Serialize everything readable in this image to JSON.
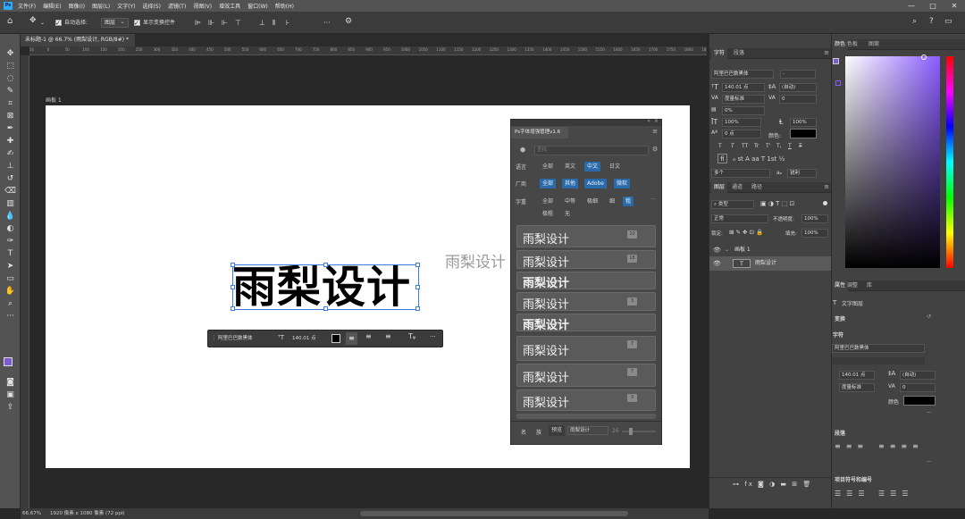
{
  "app": {
    "logo": "Ps"
  },
  "menu": [
    "文件(F)",
    "编辑(E)",
    "图像(I)",
    "图层(L)",
    "文字(Y)",
    "选择(S)",
    "滤镜(T)",
    "视图(V)",
    "增效工具",
    "窗口(W)",
    "帮助(H)"
  ],
  "window_controls": {
    "minimize": "—",
    "maximize": "□",
    "close": "✕"
  },
  "options_bar": {
    "auto_select_label": "自动选择:",
    "auto_select_value": "图层",
    "show_transform_label": "显示变换控件",
    "more": "···"
  },
  "document": {
    "tab_title": "未标题-1 @ 66.7% (雨梨设计, RGB/8#) *",
    "artboard_label": "画板 1"
  },
  "ruler_ticks": [
    "50",
    "0",
    "50",
    "100",
    "150",
    "200",
    "250",
    "300",
    "350",
    "400",
    "450",
    "500",
    "550",
    "600",
    "650",
    "700",
    "750",
    "800",
    "850",
    "900",
    "950",
    "1000",
    "1050",
    "1100",
    "1150",
    "1200",
    "1250",
    "1300",
    "1350",
    "1400",
    "1450",
    "1500",
    "1550",
    "1600",
    "1650",
    "1700",
    "1750",
    "1800",
    "1850"
  ],
  "canvas": {
    "main_text": "雨梨设计",
    "ghost_text": "雨梨设计"
  },
  "text_props": {
    "font": "阿里巴巴数黑体",
    "size": "140.01 点",
    "more": "···"
  },
  "status": {
    "zoom": "66.67%",
    "size": "1920 像素 x 1080 像素 (72 ppi)"
  },
  "plugin": {
    "title": "Ps字体增强管理v1.6",
    "search_placeholder": "查找",
    "rows": [
      {
        "label": "语言",
        "chips": [
          "全部",
          "英文",
          "中文",
          "日文"
        ],
        "active": [
          2
        ]
      },
      {
        "label": "厂商",
        "chips": [
          "全部",
          "其他",
          "Adobe",
          "微软"
        ],
        "active": [
          0,
          1,
          2,
          3
        ]
      },
      {
        "label": "字重",
        "chips": [
          "全部",
          "中等",
          "极细",
          "细",
          "粗",
          "极粗",
          "无"
        ],
        "active": [
          4
        ]
      }
    ],
    "fonts": [
      {
        "name": "雨梨设计",
        "badge": "10"
      },
      {
        "name": "雨梨设计",
        "badge": "18"
      },
      {
        "name": "雨梨设计",
        "badge": ""
      },
      {
        "name": "雨梨设计",
        "badge": "3"
      },
      {
        "name": "雨梨设计",
        "badge": ""
      },
      {
        "name": "雨梨设计",
        "badge": "7"
      },
      {
        "name": "雨梨设计",
        "badge": "7"
      },
      {
        "name": "雨梨设计",
        "badge": "3"
      }
    ],
    "footer": {
      "tab1": "名",
      "tab2": "族",
      "tab3": "预览",
      "preview_text": "雨梨设计",
      "size": "26"
    }
  },
  "character_panel": {
    "tabs": [
      "字符",
      "段落"
    ],
    "font": "阿里巴巴数黑体",
    "style": "-",
    "size": "140.01 点",
    "leading": "(自动)",
    "kerning": "度量标准",
    "tracking": "0",
    "vscale": "0%",
    "hscale1": "100%",
    "hscale2": "100%",
    "baseline": "0 点",
    "color_label": "颜色:",
    "glyphs": [
      "T",
      "T",
      "TT",
      "Tr",
      "T'",
      "T,",
      "T",
      "T"
    ],
    "lang": "多个",
    "aa": "锐利"
  },
  "layers_panel": {
    "tabs": [
      "图层",
      "通道",
      "路径"
    ],
    "filter": "类型",
    "blend": "正常",
    "opacity_label": "不透明度:",
    "opacity": "100%",
    "lock_label": "锁定:",
    "fill_label": "填充:",
    "fill": "100%",
    "layers": [
      {
        "name": "画板 1",
        "type": "artboard"
      },
      {
        "name": "雨梨设计",
        "type": "text"
      }
    ]
  },
  "color_panel": {
    "tabs": [
      "颜色",
      "色板",
      "图案"
    ]
  },
  "properties_panel": {
    "tabs": [
      "属性",
      "调整",
      "库"
    ],
    "layer_type": "文字图层",
    "transform_label": "变换",
    "character_label": "字符",
    "font": "阿里巴巴数黑体",
    "size": "140.01 点",
    "leading": "(自动)",
    "kerning": "度量标准",
    "tracking": "0",
    "color_label": "颜色",
    "paragraph_label": "段落",
    "bullets_label": "项目符号和编号",
    "more": "···"
  },
  "colors": {
    "accent": "#2b6aa8",
    "fg_swatch": "#7b5bd6",
    "picker_hue": "#8a5cff"
  }
}
